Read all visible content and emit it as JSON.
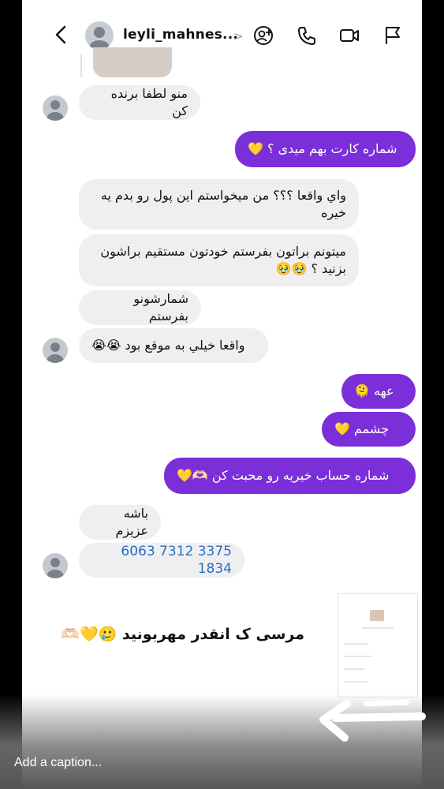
{
  "header": {
    "username": "leyli_mahnes...",
    "chevron": ">",
    "icons": [
      "back-arrow-icon",
      "avatar",
      "add-person-icon",
      "phone-icon",
      "video-camera-icon",
      "flag-icon"
    ]
  },
  "messages": [
    {
      "dir": "in",
      "text": "منو لطفا برنده کن"
    },
    {
      "dir": "out",
      "text": "شماره کارت بهم میدی ؟ 💛"
    },
    {
      "dir": "in",
      "text": "واي واقعا ؟؟؟ من ميخواستم اين پول رو بدم يه خيره"
    },
    {
      "dir": "in",
      "text": "ميتونم براتون بفرستم خودتون مستقيم براشون بزنيد ؟ 🥹🥹"
    },
    {
      "dir": "in",
      "text": "شمارشونو بفرستم"
    },
    {
      "dir": "in",
      "text": "واقعا خيلي به موقع بود 😭😭"
    },
    {
      "dir": "out",
      "text": "عهه 🫠"
    },
    {
      "dir": "out",
      "text": "چشمم 💛"
    },
    {
      "dir": "out",
      "text": "شماره حساب خیریه رو محبت کن 🫶🏻💛"
    },
    {
      "dir": "in",
      "text": "باشه عزیزم"
    },
    {
      "dir": "in",
      "text": "6063 7312 3375 1834"
    }
  ],
  "overlay": {
    "caption_text": "مرسی ک انقدر مهربونید 🥲💛🫶🏻",
    "caption_placeholder": "Add a caption..."
  },
  "colors": {
    "outgoing_bubble": "#7b2fd8",
    "incoming_bubble": "#efeff1",
    "card_number": "#2a6ec0"
  }
}
